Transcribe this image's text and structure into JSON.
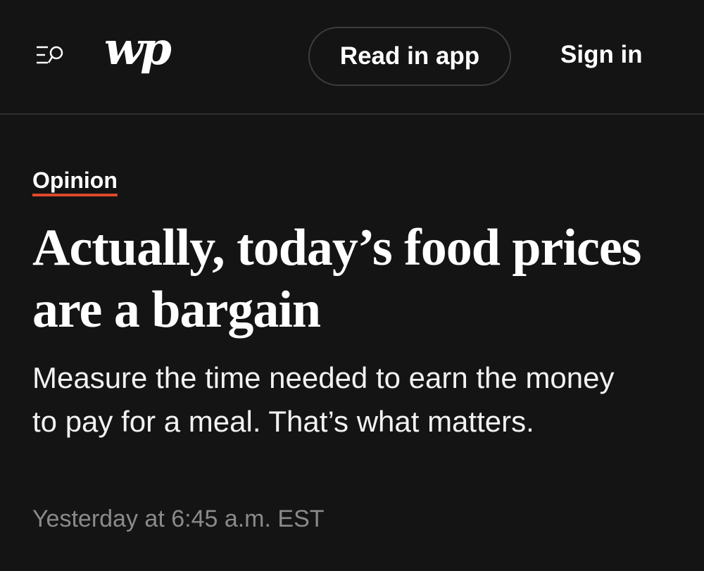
{
  "header": {
    "menu_search_icon": "menu-search-icon",
    "logo_text": "wp",
    "read_in_app_label": "Read in app",
    "sign_in_label": "Sign in"
  },
  "article": {
    "kicker": "Opinion",
    "headline": "Actually, today’s food prices are a bargain",
    "dek": "Measure the time needed to earn the money to pay for a meal. That’s what matters.",
    "timestamp": "Yesterday at 6:45 a.m. EST"
  },
  "colors": {
    "background": "#141414",
    "text": "#ffffff",
    "accent_underline": "#e0482d",
    "muted": "#8a8a8a",
    "divider": "#2e2e2e"
  }
}
